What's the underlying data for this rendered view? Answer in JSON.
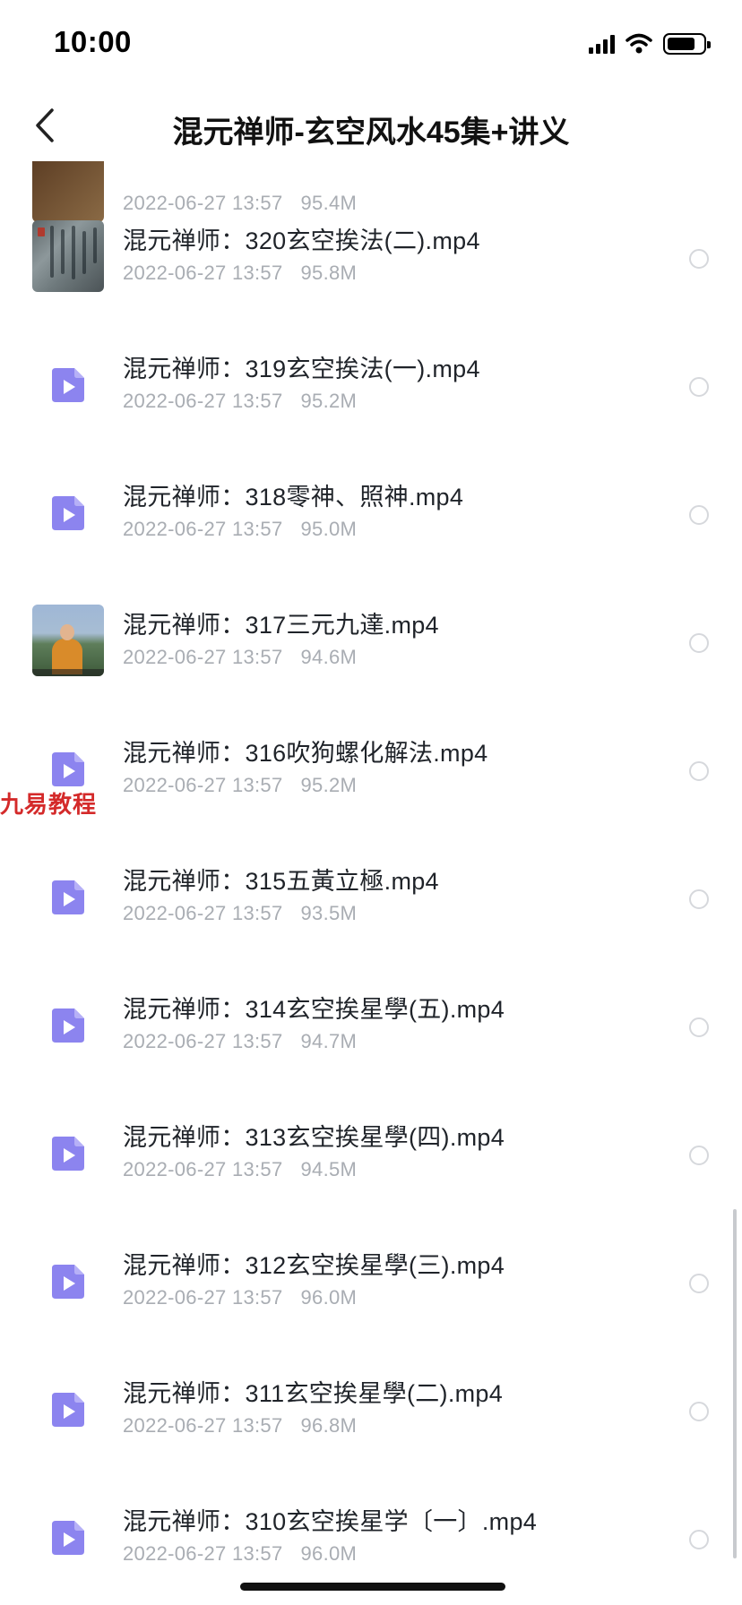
{
  "status_bar": {
    "time": "10:00"
  },
  "nav": {
    "title": "混元禅师-玄空风水45集+讲义",
    "back_icon": "chevron-left-icon"
  },
  "watermark": "九易教程",
  "files": [
    {
      "name": "",
      "date": "2022-06-27 13:57",
      "size": "95.4M",
      "thumb": "dark"
    },
    {
      "name": "混元禅师：320玄空挨法(二).mp4",
      "date": "2022-06-27 13:57",
      "size": "95.8M",
      "thumb": "scroll"
    },
    {
      "name": "混元禅师：319玄空挨法(一).mp4",
      "date": "2022-06-27 13:57",
      "size": "95.2M",
      "thumb": "video"
    },
    {
      "name": "混元禅师：318零神、照神.mp4",
      "date": "2022-06-27 13:57",
      "size": "95.0M",
      "thumb": "video"
    },
    {
      "name": "混元禅师：317三元九達.mp4",
      "date": "2022-06-27 13:57",
      "size": "94.6M",
      "thumb": "photo"
    },
    {
      "name": "混元禅师：316吹狗螺化解法.mp4",
      "date": "2022-06-27 13:57",
      "size": "95.2M",
      "thumb": "video"
    },
    {
      "name": "混元禅师：315五黃立極.mp4",
      "date": "2022-06-27 13:57",
      "size": "93.5M",
      "thumb": "video"
    },
    {
      "name": "混元禅师：314玄空挨星學(五).mp4",
      "date": "2022-06-27 13:57",
      "size": "94.7M",
      "thumb": "video"
    },
    {
      "name": "混元禅师：313玄空挨星學(四).mp4",
      "date": "2022-06-27 13:57",
      "size": "94.5M",
      "thumb": "video"
    },
    {
      "name": "混元禅师：312玄空挨星學(三).mp4",
      "date": "2022-06-27 13:57",
      "size": "96.0M",
      "thumb": "video"
    },
    {
      "name": "混元禅师：311玄空挨星學(二).mp4",
      "date": "2022-06-27 13:57",
      "size": "96.8M",
      "thumb": "video"
    },
    {
      "name": "混元禅师：310玄空挨星学〔一〕.mp4",
      "date": "2022-06-27 13:57",
      "size": "96.0M",
      "thumb": "video"
    }
  ],
  "colors": {
    "video_icon": "#8c84ef",
    "meta_text": "#a9adb3",
    "watermark": "#d42a2a",
    "radio_border": "#d6d8dc"
  }
}
